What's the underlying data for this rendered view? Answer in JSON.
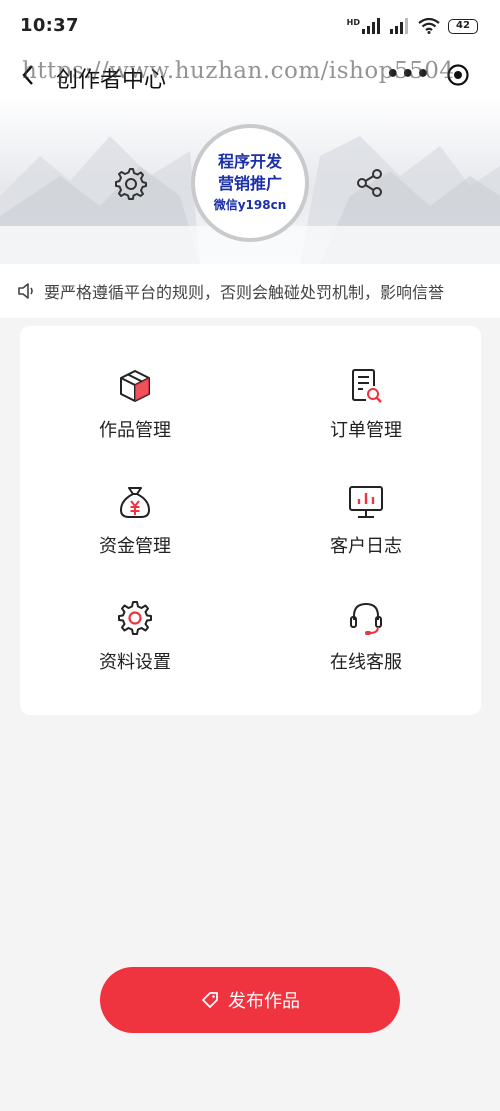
{
  "status_bar": {
    "time": "10:37",
    "battery": "42",
    "network": "HD"
  },
  "nav": {
    "title": "创作者中心"
  },
  "watermark": "https://www.huzhan.com/ishop5504",
  "banner": {
    "promo_line1": "程序开发",
    "promo_line2": "营销推广",
    "promo_line3": "微信y198cn"
  },
  "notice": {
    "text": "要严格遵循平台的规则，否则会触碰处罚机制，影响信誉"
  },
  "menu": {
    "items": [
      {
        "label": "作品管理",
        "icon": "cube-icon"
      },
      {
        "label": "订单管理",
        "icon": "order-search-icon"
      },
      {
        "label": "资金管理",
        "icon": "money-bag-icon"
      },
      {
        "label": "客户日志",
        "icon": "monitor-chart-icon"
      },
      {
        "label": "资料设置",
        "icon": "gear-icon"
      },
      {
        "label": "在线客服",
        "icon": "headset-icon"
      }
    ]
  },
  "publish": {
    "label": "发布作品"
  },
  "colors": {
    "accent": "#ef333f",
    "promo_text": "#1b2fa8",
    "page_bg": "#f4f4f5"
  }
}
